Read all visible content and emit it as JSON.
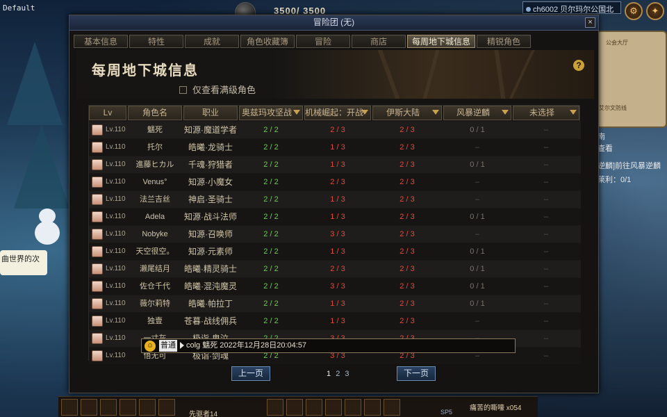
{
  "hud": {
    "top_left_label": "Default",
    "hp_text": "3500/ 3500",
    "server_label": "ch6002 贝尔玛尔公国北",
    "left_bubble_text": "曲世界的次",
    "right_side_text": [
      "南",
      "查看",
      "逆麟]前往风暴逆麟",
      "莱利：0/1"
    ],
    "minimap_labels": [
      "公会大厅",
      "艾尔文防线"
    ],
    "hotbar_label": "先驱者14",
    "sp_label": "SP5",
    "bottom_right_text": "痛苦的嘶嚎",
    "bottom_right_count": "x054"
  },
  "window": {
    "title": "冒险团 (无)",
    "close_label": "×",
    "tabs": [
      "基本信息",
      "特性",
      "成就",
      "角色收藏簿",
      "冒险",
      "商店",
      "每周地下城信息",
      "精锐角色"
    ],
    "active_tab": "每周地下城信息",
    "page_title": "每周地下城信息",
    "help_label": "?",
    "filter_label": "仅查看满级角色"
  },
  "table": {
    "headers": [
      "Lv",
      "角色名",
      "职业",
      "奥兹玛攻坚战",
      "机械崛起：开战",
      "伊斯大陆",
      "风暴逆麟",
      "未选择"
    ],
    "rows": [
      {
        "lv": "Lv.110",
        "name": "魑死",
        "job": "知源·魔道学者",
        "c1": "2 / 2",
        "c2": "2 / 3",
        "c3": "2 / 3",
        "c4": "0 / 1",
        "c5": "–"
      },
      {
        "lv": "Lv.110",
        "name": "托尔",
        "job": "皓曦·龙骑士",
        "c1": "2 / 2",
        "c2": "1 / 3",
        "c3": "2 / 3",
        "c4": "–",
        "c5": "–"
      },
      {
        "lv": "Lv.110",
        "name": "進藤ヒカル",
        "job": "千魂·狩猎者",
        "c1": "2 / 2",
        "c2": "1 / 3",
        "c3": "2 / 3",
        "c4": "0 / 1",
        "c5": "–"
      },
      {
        "lv": "Lv.110",
        "name": "Venus°",
        "job": "知源·小魔女",
        "c1": "2 / 2",
        "c2": "2 / 3",
        "c3": "2 / 3",
        "c4": "–",
        "c5": "–"
      },
      {
        "lv": "Lv.110",
        "name": "法兰吉丝",
        "job": "神启·圣骑士",
        "c1": "2 / 2",
        "c2": "1 / 3",
        "c3": "2 / 3",
        "c4": "–",
        "c5": "–"
      },
      {
        "lv": "Lv.110",
        "name": "Adela",
        "job": "知源·战斗法师",
        "c1": "2 / 2",
        "c2": "1 / 3",
        "c3": "2 / 3",
        "c4": "0 / 1",
        "c5": "–"
      },
      {
        "lv": "Lv.110",
        "name": "Nobyke",
        "job": "知源·召唤师",
        "c1": "2 / 2",
        "c2": "3 / 3",
        "c3": "2 / 3",
        "c4": "–",
        "c5": "–"
      },
      {
        "lv": "Lv.110",
        "name": "天空很空。",
        "job": "知源·元素师",
        "c1": "2 / 2",
        "c2": "1 / 3",
        "c3": "2 / 3",
        "c4": "0 / 1",
        "c5": "–"
      },
      {
        "lv": "Lv.110",
        "name": "濑尾结月",
        "job": "皓曦·精灵骑士",
        "c1": "2 / 2",
        "c2": "2 / 3",
        "c3": "2 / 3",
        "c4": "0 / 1",
        "c5": "–"
      },
      {
        "lv": "Lv.110",
        "name": "佐仓千代",
        "job": "皓曦·混沌魔灵",
        "c1": "2 / 2",
        "c2": "3 / 3",
        "c3": "2 / 3",
        "c4": "0 / 1",
        "c5": "–"
      },
      {
        "lv": "Lv.110",
        "name": "薇尔莉特",
        "job": "皓曦·帕拉丁",
        "c1": "2 / 2",
        "c2": "1 / 3",
        "c3": "2 / 3",
        "c4": "0 / 1",
        "c5": "–"
      },
      {
        "lv": "Lv.110",
        "name": "独壹",
        "job": "苍暮·战线佣兵",
        "c1": "2 / 2",
        "c2": "1 / 3",
        "c3": "2 / 3",
        "c4": "–",
        "c5": "–"
      },
      {
        "lv": "Lv.110",
        "name": "一寸灰",
        "job": "极诣·鬼泣",
        "c1": "2 / 2",
        "c2": "3 / 3",
        "c3": "2 / 3",
        "c4": "–",
        "c5": "–"
      },
      {
        "lv": "Lv.110",
        "name": "悟无可",
        "job": "极诣·剑魂",
        "c1": "2 / 2",
        "c2": "3 / 3",
        "c3": "2 / 3",
        "c4": "–",
        "c5": "–"
      }
    ]
  },
  "pager": {
    "prev_label": "上一页",
    "next_label": "下一页",
    "pages": [
      "1",
      "2",
      "3"
    ]
  },
  "chat_tooltip": {
    "channel": "普通",
    "message": "colg 魑死  2022年12月28日20:04:57"
  }
}
